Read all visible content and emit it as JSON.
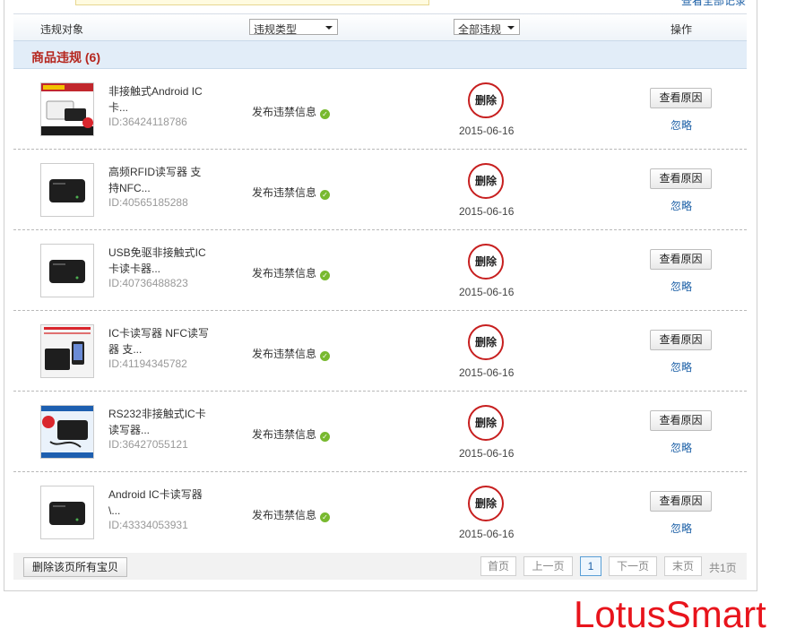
{
  "top": {
    "view_all": "查看全部记录"
  },
  "header": {
    "col_object": "违规对象",
    "type_select": "违规类型",
    "scope_select": "全部违规",
    "col_action": "操作"
  },
  "section": {
    "title": "商品违规 (6)"
  },
  "rows": [
    {
      "name": "非接触式Android IC卡...",
      "id": "ID:36424118786",
      "type": "发布违禁信息",
      "badge": "删除",
      "date": "2015-06-16",
      "reason": "查看原因",
      "ignore": "忽略"
    },
    {
      "name": "高频RFID读写器 支持NFC...",
      "id": "ID:40565185288",
      "type": "发布违禁信息",
      "badge": "删除",
      "date": "2015-06-16",
      "reason": "查看原因",
      "ignore": "忽略"
    },
    {
      "name": "USB免驱非接触式IC卡读卡器...",
      "id": "ID:40736488823",
      "type": "发布违禁信息",
      "badge": "删除",
      "date": "2015-06-16",
      "reason": "查看原因",
      "ignore": "忽略"
    },
    {
      "name": "IC卡读写器 NFC读写器 支...",
      "id": "ID:41194345782",
      "type": "发布违禁信息",
      "badge": "删除",
      "date": "2015-06-16",
      "reason": "查看原因",
      "ignore": "忽略"
    },
    {
      "name": "RS232非接触式IC卡读写器...",
      "id": "ID:36427055121",
      "type": "发布违禁信息",
      "badge": "删除",
      "date": "2015-06-16",
      "reason": "查看原因",
      "ignore": "忽略"
    },
    {
      "name": "Android IC卡读写器\\...",
      "id": "ID:43334053931",
      "type": "发布违禁信息",
      "badge": "删除",
      "date": "2015-06-16",
      "reason": "查看原因",
      "ignore": "忽略"
    }
  ],
  "footer": {
    "delete_all": "删除该页所有宝贝",
    "first": "首页",
    "prev": "上一页",
    "current": "1",
    "next": "下一页",
    "last": "末页",
    "total": "共1页"
  },
  "watermark": "LotusSmart",
  "colors": {
    "accent_red": "#c71f1f",
    "link_blue": "#1b5fa6",
    "section_bg": "#e2edf8",
    "ok_green": "#78b92f"
  }
}
